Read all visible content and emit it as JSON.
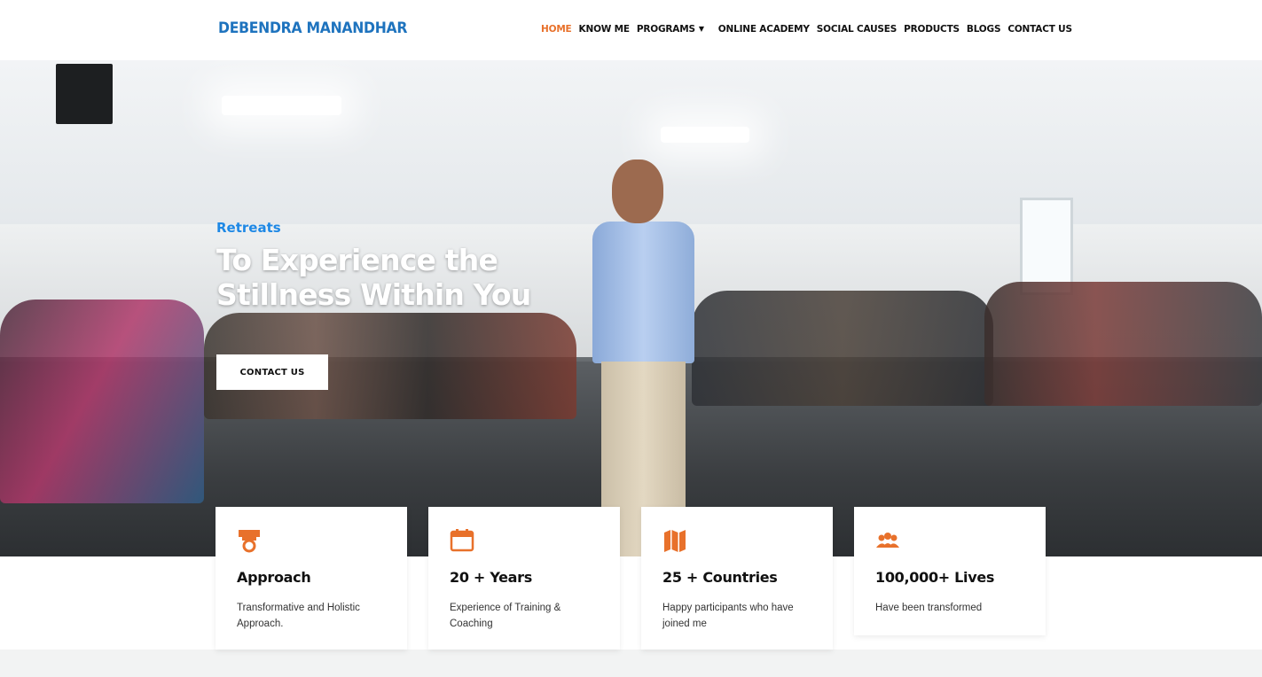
{
  "header": {
    "logo": "DEBENDRA MANANDHAR",
    "nav": {
      "home": "HOME",
      "know_me": "KNOW ME",
      "programs": "PROGRAMS",
      "online_academy": "ONLINE ACADEMY",
      "social_causes": "SOCIAL CAUSES",
      "products": "PRODUCTS",
      "blogs": "BLOGS",
      "contact_us": "CONTACT US"
    }
  },
  "hero": {
    "tag": "Retreats",
    "title": "To Experience the Stillness Within You",
    "button": "CONTACT US"
  },
  "features": [
    {
      "icon": "medal-icon",
      "title": "Approach",
      "text": "Transformative and Holistic Approach."
    },
    {
      "icon": "calendar-icon",
      "title": "20 + Years",
      "text": "Experience of Training & Coaching"
    },
    {
      "icon": "map-icon",
      "title": "25 + Countries",
      "text": "Happy participants who have joined me"
    },
    {
      "icon": "people-icon",
      "title": "100,000+ Lives",
      "text": "Have been transformed"
    }
  ],
  "colors": {
    "accent": "#e8712b",
    "brand": "#1e73be",
    "tag": "#1e88e5"
  }
}
